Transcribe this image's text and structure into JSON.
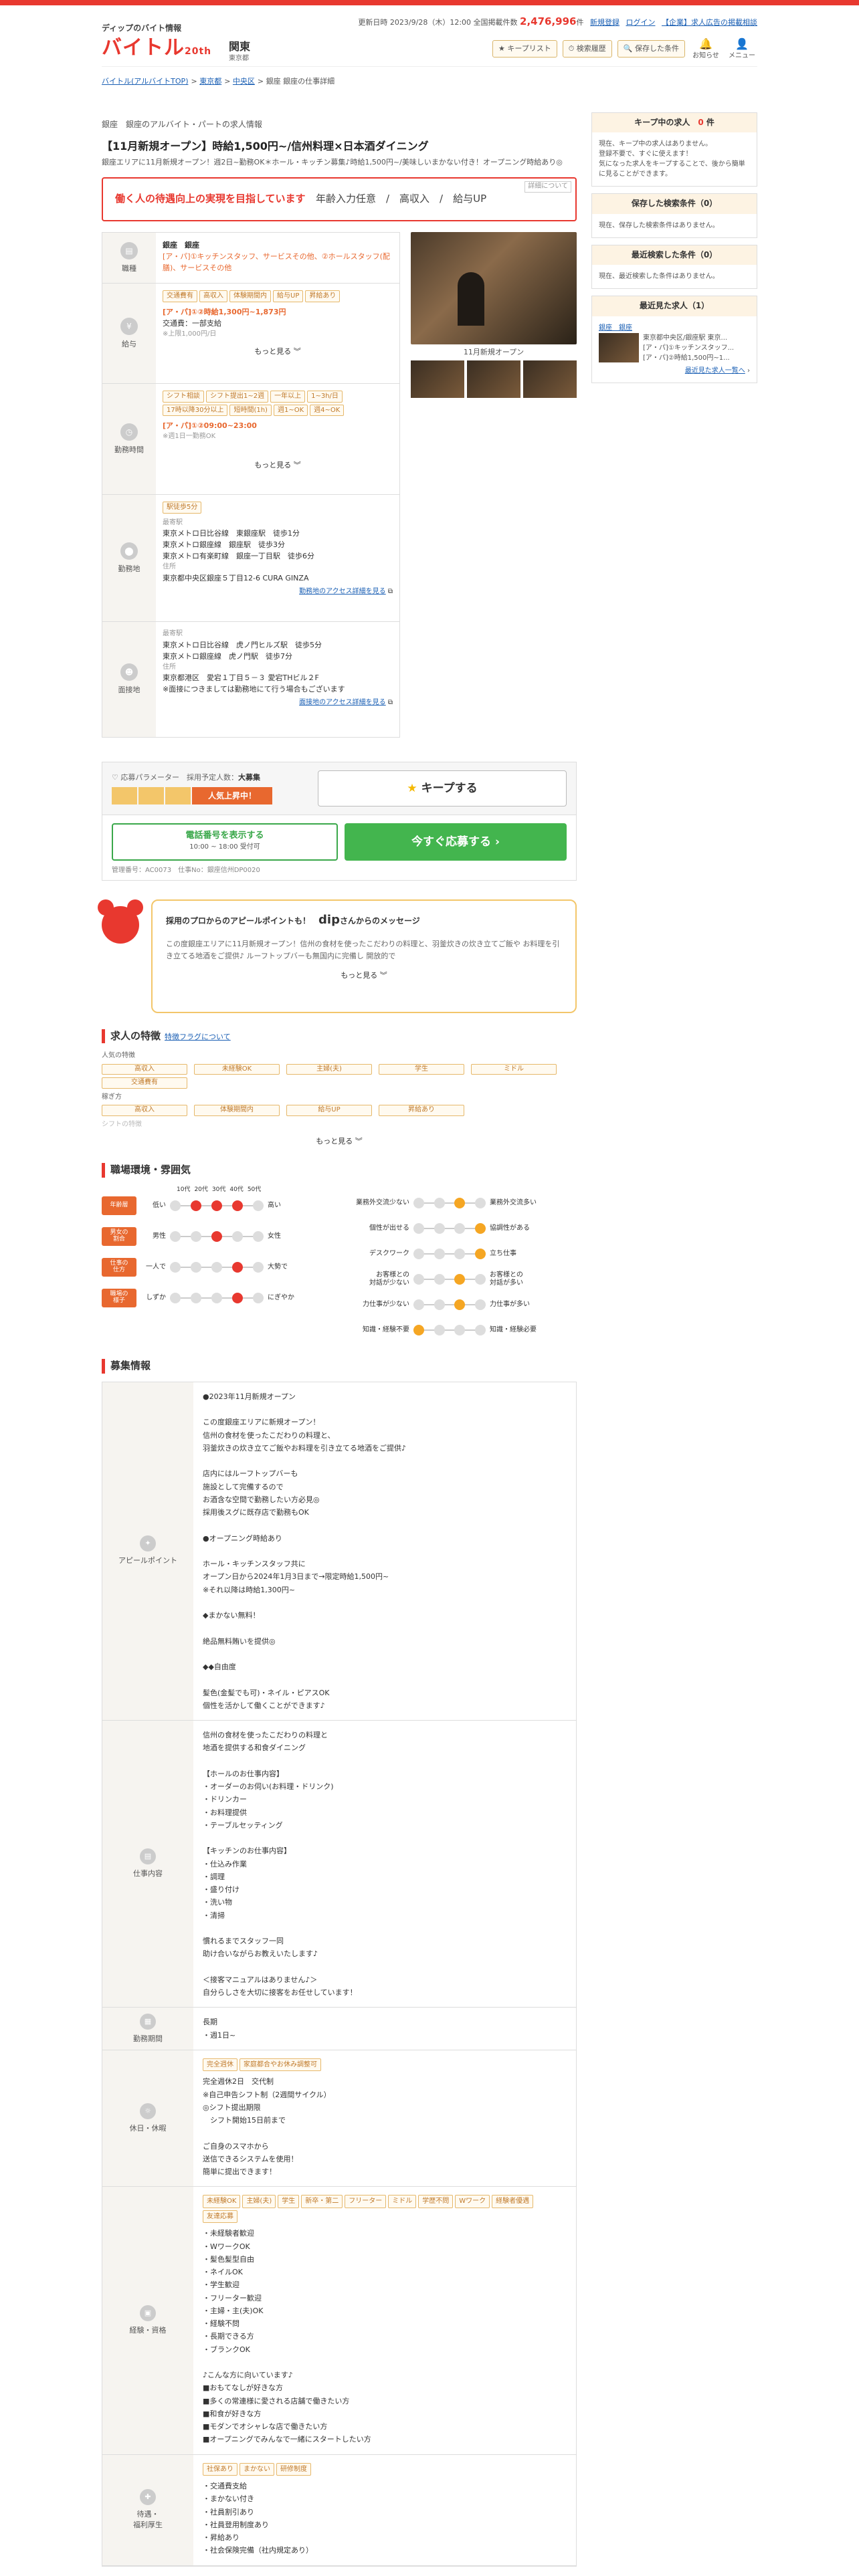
{
  "header": {
    "tagline": "ディップのバイト情報",
    "logo": "バイトル",
    "logo_badge": "20th",
    "region": "関東",
    "region_sub": "東京都",
    "update_label": "更新日時",
    "update_time": "2023/9/28（木）12:00",
    "count_label": "全国掲載件数",
    "count": "2,476,996",
    "count_unit": "件",
    "links": [
      "新規登録",
      "ログイン",
      "【企業】求人広告の掲載相談"
    ],
    "buttons": [
      "キープリスト",
      "検索履歴",
      "保存した条件"
    ],
    "icons": [
      "お知らせ",
      "メニュー"
    ]
  },
  "breadcrumb": [
    "バイトル(アルバイトTOP)",
    "東京都",
    "中央区",
    "銀座",
    "銀座の仕事詳細"
  ],
  "job": {
    "category": "銀座　銀座のアルバイト・パートの求人情報",
    "title": "【11月新規オープン】時給1,500円~/信州料理×日本酒ダイニング",
    "lead": "銀座エリアに11月新規オープン！週2日~勤務OK＊ホール・キッチン募集♪時給1,500円~/美味しいまかない付き！オープニング時給あり◎",
    "banner_text": "働く人の待遇向上の実現を目指しています",
    "banner_labels": "年齢入力任意　/　高収入　/　給与UP",
    "banner_small": "詳細について"
  },
  "info": {
    "job_label": "職種",
    "job_area": "銀座　銀座",
    "job_text": "[ア・パ]①キッチンスタッフ、サービスその他、②ホールスタッフ(配膳)、サービスその他",
    "pay_label": "給与",
    "pay_tags": [
      "交通費有",
      "高収入",
      "体験期間内",
      "給与UP",
      "昇給あり"
    ],
    "pay_text": "[ア・パ]①②時給1,300円~1,873円",
    "pay_text2": "交通費：一部支給",
    "pay_note": "※上限1,000円/日",
    "more": "もっと見る",
    "time_label": "勤務時間",
    "time_tags": [
      "シフト相談",
      "シフト提出1~2週",
      "一年以上",
      "1~3h/日",
      "17時以降30分以上",
      "短時間(1h)",
      "週1~OK",
      "週4~OK"
    ],
    "time_text": "[ア・パ]①②09:00~23:00",
    "time_note": "※週1日一勤務OK",
    "loc_label": "勤務地",
    "loc_tag": "駅徒歩5分",
    "loc_station_label": "最寄駅",
    "loc_stations": "東京メトロ日比谷線　東銀座駅　徒歩1分\n東京メトロ銀座線　銀座駅　徒歩3分\n東京メトロ有楽町線　銀座一丁目駅　徒歩6分",
    "loc_addr_label": "住所",
    "loc_addr": "東京都中央区銀座５丁目12-6 CURA GINZA",
    "loc_link": "勤務地のアクセス詳細を見る",
    "int_label": "面接地",
    "int_station_label": "最寄駅",
    "int_stations": "東京メトロ日比谷線　虎ノ門ヒルズ駅　徒歩5分\n東京メトロ銀座線　虎ノ門駅　徒歩7分",
    "int_addr_label": "住所",
    "int_addr": "東京都港区　愛宕１丁目５－３ 愛宕THビル２F",
    "int_note": "※面接につきましては勤務地にて行う場合もございます",
    "int_link": "面接地のアクセス詳細を見る",
    "photo_caption": "11月新規オープン"
  },
  "param": {
    "label": "応募パラメーター",
    "hire_label": "採用予定人数：",
    "hire": "大募集",
    "hot": "人気上昇中！",
    "keep": "キープする",
    "tel": "電話番号を表示する",
    "tel_hours": "10:00 ~ 18:00 受付可",
    "apply": "今すぐ応募する",
    "mgmt": "管理番号：AC0073　仕事No：銀座信州DP0020"
  },
  "message": {
    "pre": "採用のプロからのアピールポイントも！",
    "brand": "dip",
    "post": "さんからのメッセージ",
    "text": "この度銀座エリアに11月新規オープン！信州の食材を使ったこだわりの料理と、羽釜炊きの炊き立てご飯や お料理を引き立てる地酒をご提供♪ ルーフトップバーも無国内に完備し 開放的で",
    "more": "もっと見る"
  },
  "features": {
    "title": "求人の特徴",
    "link": "特徴フラグについて",
    "g1": "人気の特徴",
    "g1_tags": [
      "高収入",
      "未経験OK",
      "主婦(夫)",
      "学生",
      "ミドル",
      "交通費有"
    ],
    "g2": "稼ぎ方",
    "g2_tags": [
      "高収入",
      "体験期間内",
      "給与UP",
      "昇給あり"
    ],
    "g3": "シフトの特徴",
    "more": "もっと見る"
  },
  "env": {
    "title": "職場環境・雰囲気",
    "ages": [
      "10代",
      "20代",
      "30代",
      "40代",
      "50代"
    ],
    "left": [
      {
        "badge": "年齢層",
        "l": "低い",
        "r": "高い",
        "on": [
          1,
          2,
          3
        ]
      },
      {
        "badge": "男女の\n割合",
        "l": "男性",
        "r": "女性",
        "on": [
          2
        ]
      },
      {
        "badge": "仕事の\n仕方",
        "l": "一人で",
        "r": "大勢で",
        "on": [
          3
        ]
      },
      {
        "badge": "職場の\n様子",
        "l": "しずか",
        "r": "にぎやか",
        "on": [
          3
        ]
      }
    ],
    "right": [
      {
        "l": "業務外交流少ない",
        "r": "業務外交流多い",
        "on": 2
      },
      {
        "l": "個性が出せる",
        "r": "協調性がある",
        "on": 3
      },
      {
        "l": "デスクワーク",
        "r": "立ち仕事",
        "on": 3
      },
      {
        "l": "お客様との\n対話が少ない",
        "r": "お客様との\n対話が多い",
        "on": 2
      },
      {
        "l": "力仕事が少ない",
        "r": "力仕事が多い",
        "on": 2
      },
      {
        "l": "知識・経験不要",
        "r": "知識・経験必要",
        "on": 0
      }
    ]
  },
  "recruit": {
    "title": "募集情報",
    "rows": [
      {
        "label": "アピールポイント",
        "icon": "✦",
        "text": "●2023年11月新規オープン\n\nこの度銀座エリアに新規オープン！\n信州の食材を使ったこだわりの料理と、\n羽釜炊きの炊き立てご飯やお料理を引き立てる地酒をご提供♪\n\n店内にはルーフトップバーも\n施設として完備するので\nお酒含な空間で勤務したい方必見◎\n採用後スグに既存店で勤務もOK\n\n●オープニング時給あり\n\nホール・キッチンスタッフ共に\nオープン日から2024年1月3日まで→限定時給1,500円~\n※それ以降は時給1,300円~\n\n◆まかない無料！\n\n絶品無料賄いを提供◎\n\n◆◆自由度\n\n髪色(金髪でも可)・ネイル・ピアスOK\n個性を活かして働くことができます♪"
      },
      {
        "label": "仕事内容",
        "icon": "▤",
        "text": "信州の食材を使ったこだわりの料理と\n地酒を提供する和食ダイニング\n\n【ホールのお仕事内容】\n・オーダーのお伺い(お料理・ドリンク)\n・ドリンカー\n・お料理提供\n・テーブルセッティング\n\n【キッチンのお仕事内容】\n・仕込み作業\n・調理\n・盛り付け\n・洗い物\n・清掃\n\n慣れるまでスタッフ一同\n助け合いながらお教えいたします♪\n\n＜接客マニュアルはありません♪＞\n自分らしさを大切に接客をお任せしています！"
      },
      {
        "label": "勤務期間",
        "icon": "▦",
        "text": "長期\n・週1日~"
      },
      {
        "label": "休日・休暇",
        "icon": "☼",
        "tags": [
          "完全週休",
          "家庭都合やお休み調整可"
        ],
        "text": "完全週休2日　交代制\n※自己申告シフト制（2週間サイクル）\n◎シフト提出期限\n　シフト開始15日前まで\n\nご自身のスマホから\n送信できるシステムを使用！\n簡単に提出できます！"
      },
      {
        "label": "経験・資格",
        "icon": "▣",
        "tags": [
          "未経験OK",
          "主婦(夫)",
          "学生",
          "新卒・第二",
          "フリーター",
          "ミドル",
          "学歴不問",
          "Wワーク",
          "経験者優遇",
          "友達応募"
        ],
        "text": "・未経験者歓迎\n・WワークOK\n・髪色髪型自由\n・ネイルOK\n・学生歓迎\n・フリーター歓迎\n・主婦・主(夫)OK\n・経験不問\n・長期できる方\n・ブランクOK\n\n♪こんな方に向いています♪\n■おもてなしが好きな方\n■多くの常連様に愛される店舗で働きたい方\n■和食が好きな方\n■モダンでオシャレな店で働きたい方\n■オープニングでみんなで一緒にスタートしたい方"
      },
      {
        "label": "待遇・\n福利厚生",
        "icon": "✚",
        "tags": [
          "社保あり",
          "まかない",
          "研修制度"
        ],
        "text": "・交通費支給\n・まかない付き\n・社員割引あり\n・社員登用制度あり\n・昇給あり\n・社会保険完備（社内規定あり）"
      }
    ]
  },
  "side": {
    "keep_title": "キープ中の求人",
    "keep_count": "0",
    "keep_unit": "件",
    "keep_text": "現在、キープ中の求人はありません。\n登録不要で、すぐに使えます！\n気になった求人をキープすることで、後から簡単に見ることができます。",
    "saved_title": "保存した検索条件（0）",
    "saved_text": "現在、保存した検索条件はありません。",
    "recent_cond_title": "最近検索した条件（0）",
    "recent_cond_text": "現在、最近検索した条件はありません。",
    "recent_job_title": "最近見た求人（1）",
    "recent_job_area": "銀座　銀座",
    "recent_job_text": "東京都中央区/銀座駅 東京...\n[ア・パ]①キッチンスタッフ...\n[ア・パ]②時給1,500円~1...",
    "recent_link": "最近見た求人一覧へ"
  }
}
